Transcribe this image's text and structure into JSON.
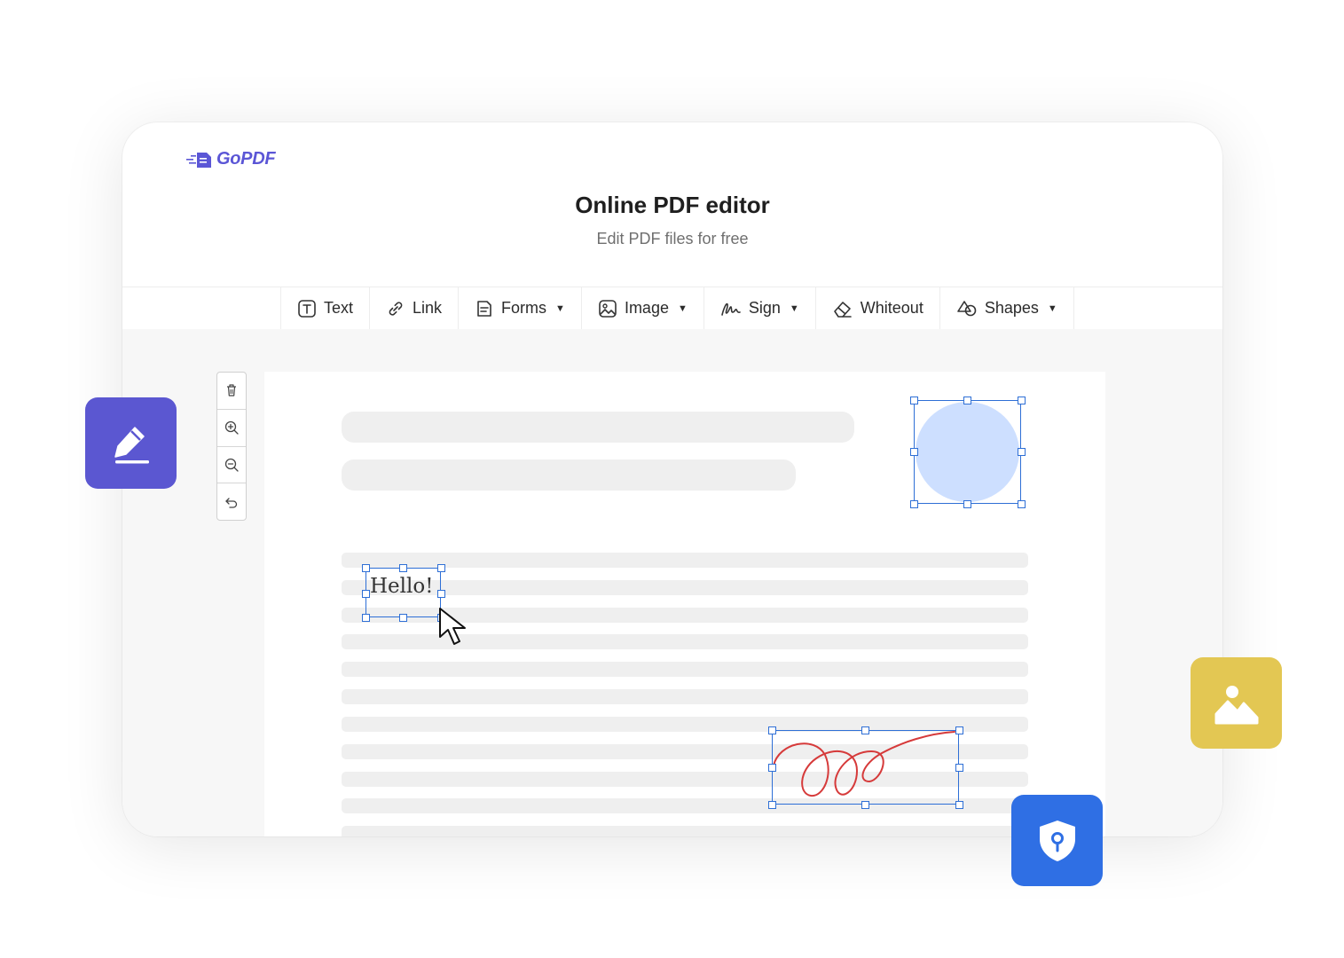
{
  "app": {
    "logo_text": "GoPDF",
    "title": "Online PDF editor",
    "subtitle": "Edit PDF files for free"
  },
  "toolbar": {
    "items": [
      {
        "label": "Text",
        "icon": "text-icon",
        "has_dropdown": false
      },
      {
        "label": "Link",
        "icon": "link-icon",
        "has_dropdown": false
      },
      {
        "label": "Forms",
        "icon": "forms-icon",
        "has_dropdown": true
      },
      {
        "label": "Image",
        "icon": "image-icon",
        "has_dropdown": true
      },
      {
        "label": "Sign",
        "icon": "sign-icon",
        "has_dropdown": true
      },
      {
        "label": "Whiteout",
        "icon": "eraser-icon",
        "has_dropdown": false
      },
      {
        "label": "Shapes",
        "icon": "shapes-icon",
        "has_dropdown": true
      }
    ]
  },
  "side_tools": [
    {
      "icon": "trash-icon"
    },
    {
      "icon": "zoom-in-icon"
    },
    {
      "icon": "zoom-out-icon"
    },
    {
      "icon": "undo-icon"
    }
  ],
  "canvas": {
    "text_annotation": "Hello!"
  },
  "floating_badges": [
    {
      "icon": "edit-pen-icon",
      "color": "#5b57d1"
    },
    {
      "icon": "image-icon",
      "color": "#e3c753"
    },
    {
      "icon": "shield-lock-icon",
      "color": "#2f6fe4"
    }
  ],
  "colors": {
    "brand": "#5b56d6",
    "selection": "#2e6fd6",
    "circle_fill": "#cddfff",
    "signature": "#d63a3a"
  }
}
